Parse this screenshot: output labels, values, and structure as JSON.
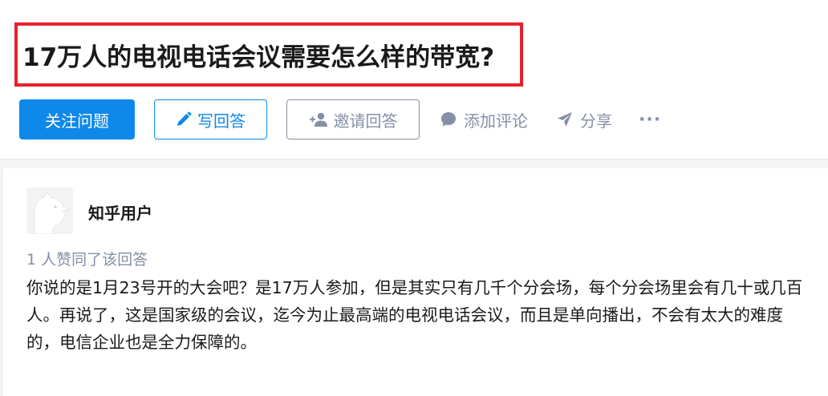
{
  "question": {
    "title": "17万人的电视电话会议需要怎么样的带宽?"
  },
  "actions": {
    "follow_label": "关注问题",
    "write_label": "写回答",
    "invite_label": "邀请回答",
    "comment_label": "添加评论",
    "share_label": "分享",
    "more_label": "···"
  },
  "answer": {
    "author": "知乎用户",
    "votes_text": "1 人赞同了该回答",
    "content": "你说的是1月23号开的大会吧？是17万人参加，但是其实只有几千个分会场，每个分会场里会有几十或几百人。再说了，这是国家级的会议，迄今为止最高端的电视电话会议，而且是单向播出，不会有太大的难度的，电信企业也是全力保障的。"
  },
  "colors": {
    "primary": "#0f88eb",
    "muted": "#8590a6",
    "highlight_border": "#e8202c"
  },
  "icons": [
    "pencil-icon",
    "add-user-icon",
    "comment-icon",
    "share-plane-icon",
    "more-dots-icon"
  ]
}
